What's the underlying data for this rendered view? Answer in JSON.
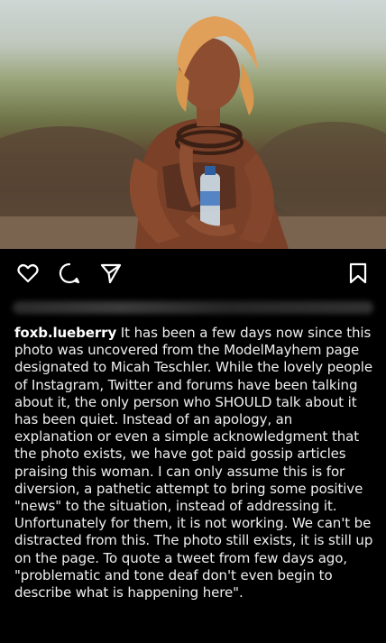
{
  "post": {
    "username": "foxb.lueberry",
    "caption": "It has been a few days now since this photo was uncovered from the ModelMayhem page designated to Micah Teschler. While the lovely people of Instagram, Twitter and forums have been talking about it, the only person who SHOULD talk about it has been quiet. Instead of an apology, an explanation or even a simple acknowledgment that the photo exists, we have got paid gossip articles praising this woman. I can only assume this is for diversion, a pathetic attempt to bring some positive \"news\" to the situation, instead of addressing it. Unfortunately for them, it is not working. We can't be distracted from this. The photo still exists, it is still up on the page. To quote a tweet from few days ago, \"problematic and tone deaf don't even begin to describe what is happening here\"."
  },
  "actions": {
    "icons": [
      "heart-icon",
      "comment-icon",
      "share-icon",
      "bookmark-icon"
    ]
  },
  "colors": {
    "background": "#000000",
    "text": "#efefef",
    "icon": "#ffffff"
  }
}
